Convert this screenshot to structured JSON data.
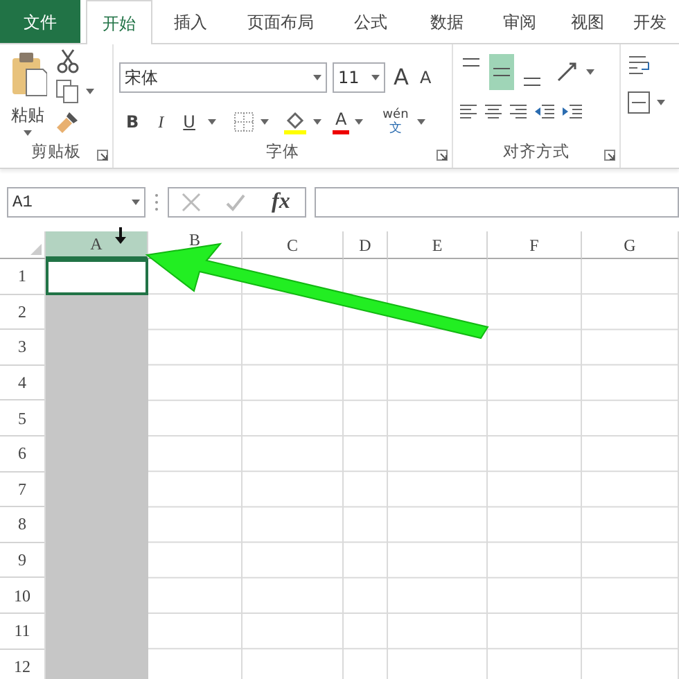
{
  "tabs": [
    {
      "label": "文件",
      "kind": "file",
      "selected": false
    },
    {
      "label": "开始",
      "kind": "tab",
      "selected": true
    },
    {
      "label": "插入",
      "kind": "tab",
      "selected": false
    },
    {
      "label": "页面布局",
      "kind": "tab",
      "selected": false
    },
    {
      "label": "公式",
      "kind": "tab",
      "selected": false
    },
    {
      "label": "数据",
      "kind": "tab",
      "selected": false
    },
    {
      "label": "审阅",
      "kind": "tab",
      "selected": false
    },
    {
      "label": "视图",
      "kind": "tab",
      "selected": false
    },
    {
      "label": "开发",
      "kind": "tab",
      "selected": false
    }
  ],
  "ribbon": {
    "clipboard": {
      "paste_label": "粘贴",
      "group_label": "剪贴板"
    },
    "font": {
      "font_name": "宋体",
      "font_size": "11",
      "grow_label": "A",
      "shrink_label": "A",
      "bold_label": "B",
      "italic_label": "I",
      "underline_label": "U",
      "font_color_label": "A",
      "pinyin": "wén",
      "pinyin_char": "文",
      "group_label": "字体"
    },
    "alignment": {
      "vertical": [
        {
          "selected": false
        },
        {
          "selected": true
        },
        {
          "selected": false
        }
      ],
      "group_label": "对齐方式"
    }
  },
  "formula_bar": {
    "name_box": "A1",
    "fx_label": "fx"
  },
  "sheet": {
    "columns": [
      {
        "label": "A",
        "selected": true
      },
      {
        "label": "B",
        "selected": false
      },
      {
        "label": "C",
        "selected": false
      },
      {
        "label": "D",
        "selected": false
      },
      {
        "label": "E",
        "selected": false
      },
      {
        "label": "F",
        "selected": false
      },
      {
        "label": "G",
        "selected": false
      }
    ],
    "rows": [
      "1",
      "2",
      "3",
      "4",
      "5",
      "6",
      "7",
      "8",
      "9",
      "10",
      "11",
      "12"
    ]
  }
}
